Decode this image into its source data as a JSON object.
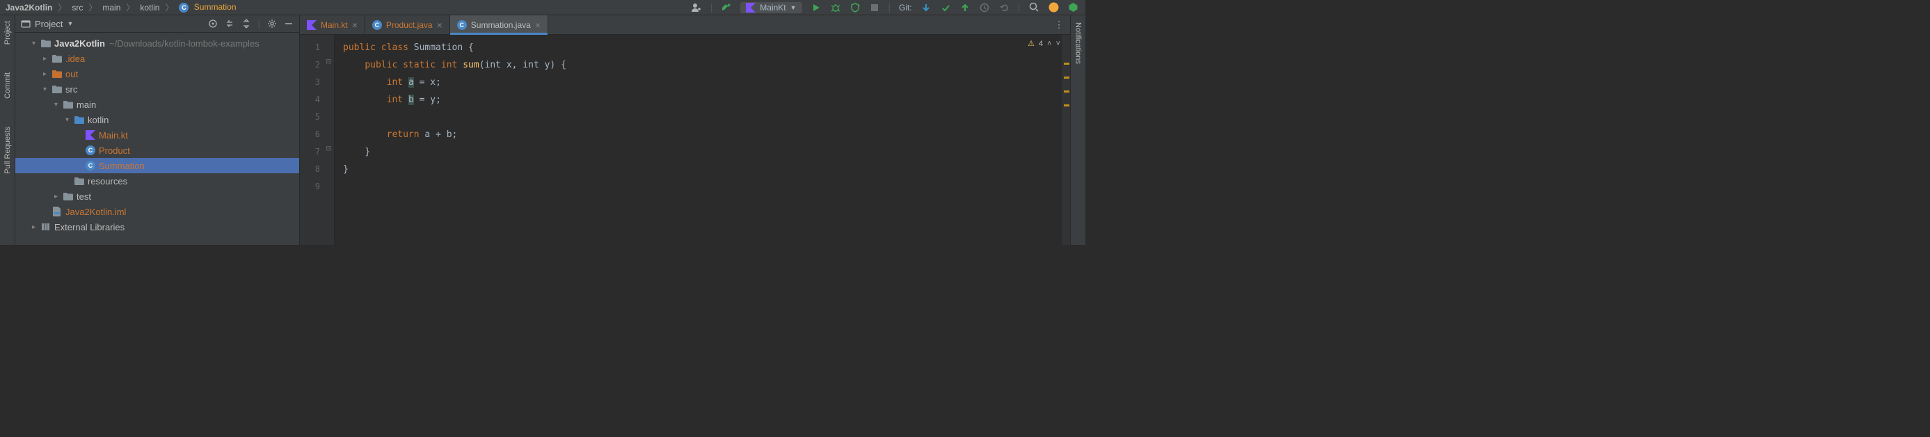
{
  "breadcrumbs": {
    "items": [
      "Java2Kotlin",
      "src",
      "main",
      "kotlin"
    ],
    "last": "Summation"
  },
  "run_config": {
    "label": "MainKt"
  },
  "git_label": "Git:",
  "sidebars": {
    "left": [
      "Project",
      "Commit",
      "Pull Requests"
    ],
    "right": [
      "Notifications"
    ]
  },
  "project_panel": {
    "title": "Project",
    "root": {
      "name": "Java2Kotlin",
      "path": "~/Downloads/kotlin-lombok-examples"
    },
    "tree": [
      {
        "indent": 1,
        "chev": "v",
        "icon": "folder",
        "label": "Java2Kotlin",
        "bold": true,
        "path": "~/Downloads/kotlin-lombok-examples"
      },
      {
        "indent": 2,
        "chev": ">",
        "icon": "folder",
        "label": ".idea",
        "orange": true
      },
      {
        "indent": 2,
        "chev": ">",
        "icon": "folder-orange",
        "label": "out",
        "orange": true
      },
      {
        "indent": 2,
        "chev": "v",
        "icon": "folder",
        "label": "src"
      },
      {
        "indent": 3,
        "chev": "v",
        "icon": "folder",
        "label": "main"
      },
      {
        "indent": 4,
        "chev": "v",
        "icon": "folder-blue",
        "label": "kotlin"
      },
      {
        "indent": 5,
        "chev": "",
        "icon": "kt",
        "label": "Main.kt",
        "orange": true
      },
      {
        "indent": 5,
        "chev": "",
        "icon": "class",
        "label": "Product",
        "orange": true
      },
      {
        "indent": 5,
        "chev": "",
        "icon": "class",
        "label": "Summation",
        "orange": true,
        "selected": true
      },
      {
        "indent": 4,
        "chev": "",
        "icon": "folder",
        "label": "resources"
      },
      {
        "indent": 3,
        "chev": ">",
        "icon": "folder",
        "label": "test"
      },
      {
        "indent": 2,
        "chev": "",
        "icon": "iml",
        "label": "Java2Kotlin.iml",
        "orange": true
      },
      {
        "indent": 1,
        "chev": ">",
        "icon": "lib",
        "label": "External Libraries"
      }
    ]
  },
  "tabs": [
    {
      "icon": "kt",
      "label": "Main.kt",
      "orange": true,
      "active": false
    },
    {
      "icon": "class",
      "label": "Product.java",
      "orange": true,
      "active": false
    },
    {
      "icon": "class",
      "label": "Summation.java",
      "orange": false,
      "active": true
    }
  ],
  "inspection": {
    "count": "4"
  },
  "gutter": {
    "lines": [
      "1",
      "2",
      "3",
      "4",
      "5",
      "6",
      "7",
      "8",
      "9"
    ]
  },
  "code": {
    "l1": {
      "kw1": "public class ",
      "name": "Summation ",
      "rest": "{"
    },
    "l2": {
      "pad": "    ",
      "kw": "public static int ",
      "fn": "sum",
      "rest": "(int x, int y) {"
    },
    "l3": {
      "pad": "        ",
      "kw": "int ",
      "var": "a",
      "rest": " = x;"
    },
    "l4": {
      "pad": "        ",
      "kw": "int ",
      "var": "b",
      "rest": " = y;"
    },
    "l6": {
      "pad": "        ",
      "kw": "return ",
      "rest": "a + b;"
    },
    "l7": {
      "pad": "    ",
      "rest": "}"
    },
    "l8": {
      "rest": "}"
    }
  }
}
